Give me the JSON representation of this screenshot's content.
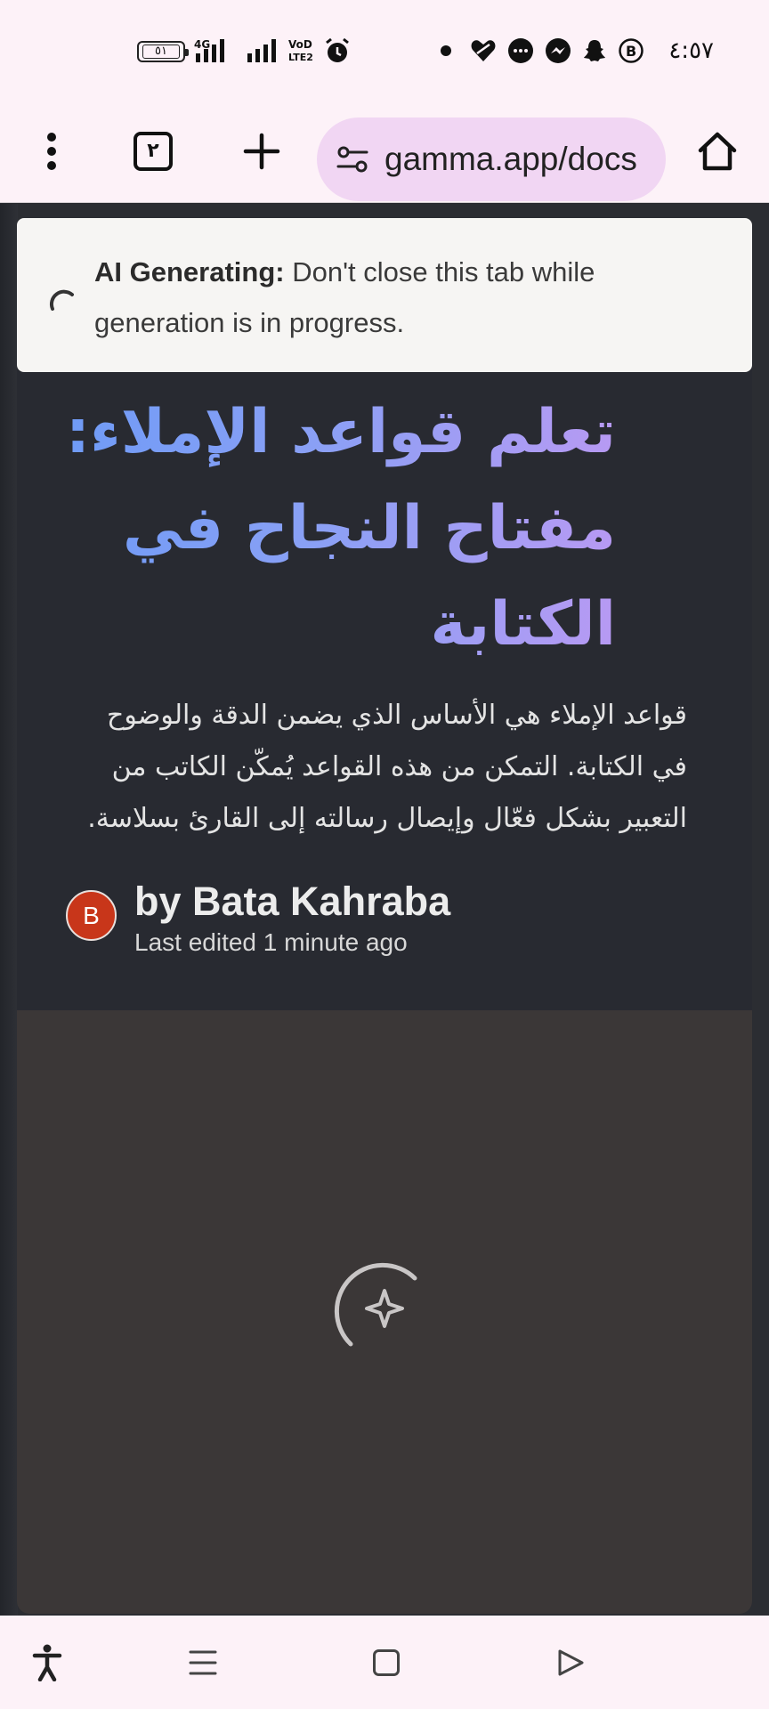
{
  "status_bar": {
    "battery": "٥١",
    "network": "4G",
    "volte": "Vo LTE2",
    "time": "٤:٥٧"
  },
  "browser": {
    "tab_count": "٢",
    "url": "gamma.app/docs"
  },
  "banner": {
    "title": "AI Generating:",
    "message": " Don't close this tab while generation is in progress."
  },
  "doc": {
    "title": "تعلم قواعد الإملاء: مفتاح النجاح في الكتابة",
    "intro": "قواعد الإملاء هي الأساس الذي يضمن الدقة والوضوح في الكتابة. التمكن من هذه القواعد يُمكّن الكاتب من التعبير بشكل فعّال وإيصال رسالته إلى القارئ بسلاسة.",
    "author_initial": "B",
    "author": "by Bata Kahraba",
    "edited": "Last edited 1 minute ago"
  },
  "icons": {
    "menu": "more-vert-icon",
    "new_tab": "plus-icon",
    "site_settings": "tune-icon",
    "home": "home-icon",
    "loader": "sparkle-icon",
    "nav": [
      "accessibility-icon",
      "menu-icon",
      "square-icon",
      "back-triangle-icon"
    ]
  },
  "colors": {
    "title_gradient_start": "#6f9bf6",
    "title_gradient_end": "#b79af3",
    "avatar": "#c8361a",
    "url_pill": "#f1d6f3"
  }
}
